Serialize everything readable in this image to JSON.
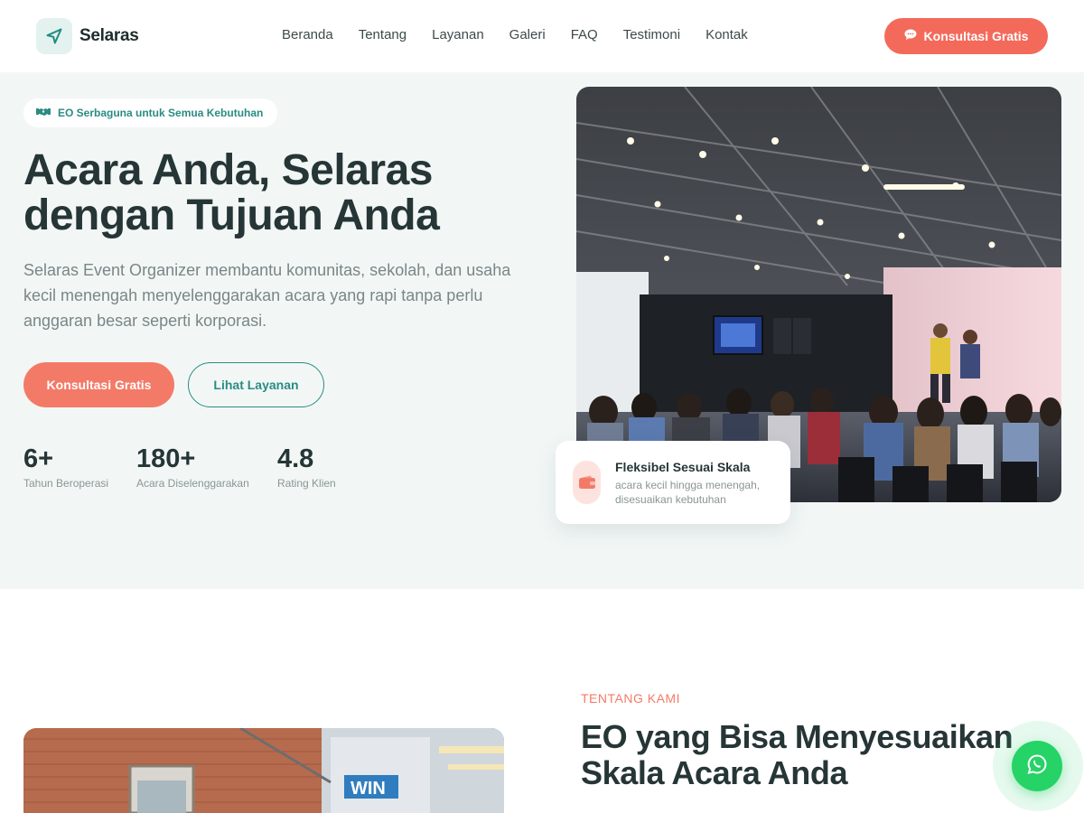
{
  "brand": {
    "name": "Selaras"
  },
  "nav": [
    {
      "label": "Beranda"
    },
    {
      "label": "Tentang"
    },
    {
      "label": "Layanan"
    },
    {
      "label": "Galeri"
    },
    {
      "label": "FAQ"
    },
    {
      "label": "Testimoni"
    },
    {
      "label": "Kontak"
    }
  ],
  "header_cta": {
    "label": "Konsultasi Gratis",
    "icon": "chat-bubble-icon"
  },
  "hero": {
    "badge": "EO Serbaguna untuk Semua Kebutuhan",
    "badge_icon": "handshake-icon",
    "title_line1": "Acara Anda, Selaras",
    "title_line2": "dengan Tujuan Anda",
    "description": "Selaras Event Organizer membantu komunitas, sekolah, dan usaha kecil menengah menyelenggarakan acara yang rapi tanpa perlu anggaran besar seperti korporasi.",
    "primary_button": "Konsultasi Gratis",
    "secondary_button": "Lihat Layanan",
    "stats": [
      {
        "value": "6+",
        "label": "Tahun Beroperasi"
      },
      {
        "value": "180+",
        "label": "Acara Diselenggarakan"
      },
      {
        "value": "4.8",
        "label": "Rating Klien"
      }
    ],
    "feature_card": {
      "title": "Fleksibel Sesuai Skala",
      "subtitle": "acara kecil hingga menengah, disesuaikan kebutuhan",
      "icon": "wallet-icon"
    }
  },
  "about": {
    "eyebrow": "TENTANG KAMI",
    "title": "EO yang Bisa Menyesuaikan Skala Acara Anda"
  },
  "colors": {
    "accent": "#f47a68",
    "teal": "#2a8c83",
    "hero_bg": "#f2f7f6",
    "heading": "#263535",
    "whatsapp": "#25d366"
  }
}
